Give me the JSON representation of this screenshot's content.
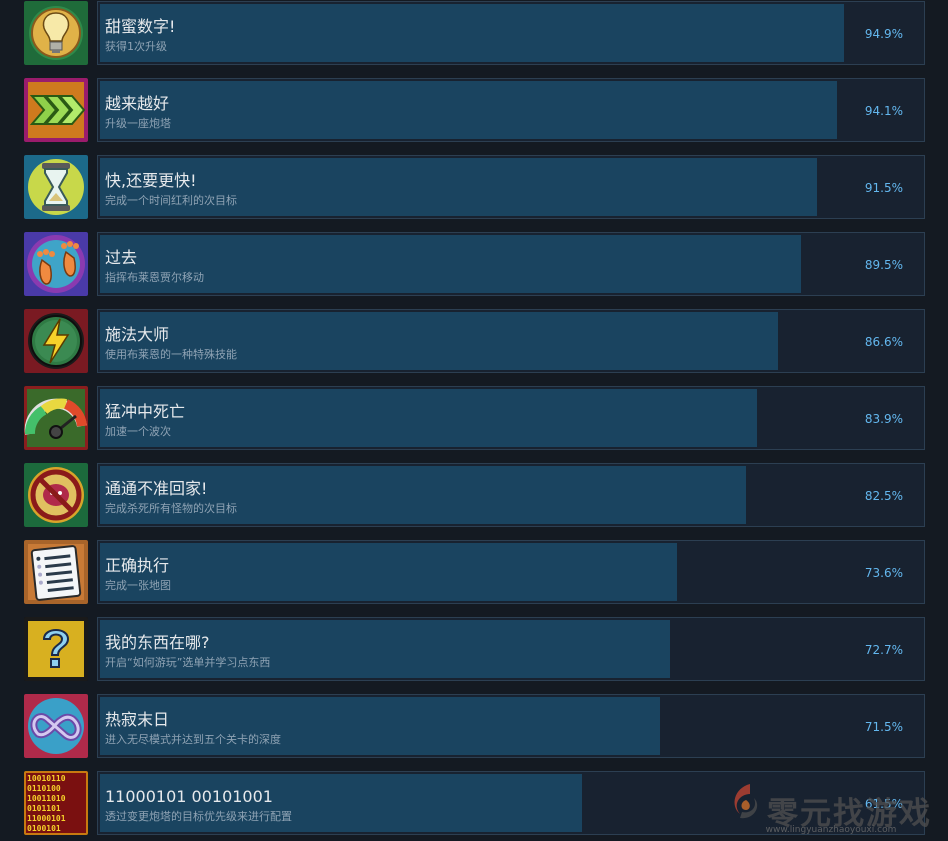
{
  "achievements": [
    {
      "title": "甜蜜数字!",
      "desc": "获得1次升级",
      "percent": "94.9%",
      "percent_value": 94.9,
      "icon": "lightbulb-icon"
    },
    {
      "title": "越来越好",
      "desc": "升级一座炮塔",
      "percent": "94.1%",
      "percent_value": 94.1,
      "icon": "triple-chevron-icon"
    },
    {
      "title": "快,还要更快!",
      "desc": "完成一个时间红利的次目标",
      "percent": "91.5%",
      "percent_value": 91.5,
      "icon": "hourglass-icon"
    },
    {
      "title": "过去",
      "desc": "指挥布莱恩贾尔移动",
      "percent": "89.5%",
      "percent_value": 89.5,
      "icon": "footprints-icon"
    },
    {
      "title": "施法大师",
      "desc": "使用布莱恩的一种特殊技能",
      "percent": "86.6%",
      "percent_value": 86.6,
      "icon": "lightning-icon"
    },
    {
      "title": "猛冲中死亡",
      "desc": "加速一个波次",
      "percent": "83.9%",
      "percent_value": 83.9,
      "icon": "speedometer-icon"
    },
    {
      "title": "通通不准回家!",
      "desc": "完成杀死所有怪物的次目标",
      "percent": "82.5%",
      "percent_value": 82.5,
      "icon": "no-monster-icon"
    },
    {
      "title": "正确执行",
      "desc": "完成一张地图",
      "percent": "73.6%",
      "percent_value": 73.6,
      "icon": "checklist-icon"
    },
    {
      "title": "我的东西在哪?",
      "desc": "开启“如何游玩”选单并学习点东西",
      "percent": "72.7%",
      "percent_value": 72.7,
      "icon": "question-mark-icon"
    },
    {
      "title": "热寂末日",
      "desc": "进入无尽模式并达到五个关卡的深度",
      "percent": "71.5%",
      "percent_value": 71.5,
      "icon": "infinity-icon"
    },
    {
      "title": "11000101 00101001",
      "desc": "透过变更炮塔的目标优先级来进行配置",
      "percent": "61.5%",
      "percent_value": 61.5,
      "icon": "binary-code-icon"
    }
  ],
  "watermark": {
    "text": "零元找游戏",
    "url": "www.lingyuanzhaoyouxi.com"
  }
}
